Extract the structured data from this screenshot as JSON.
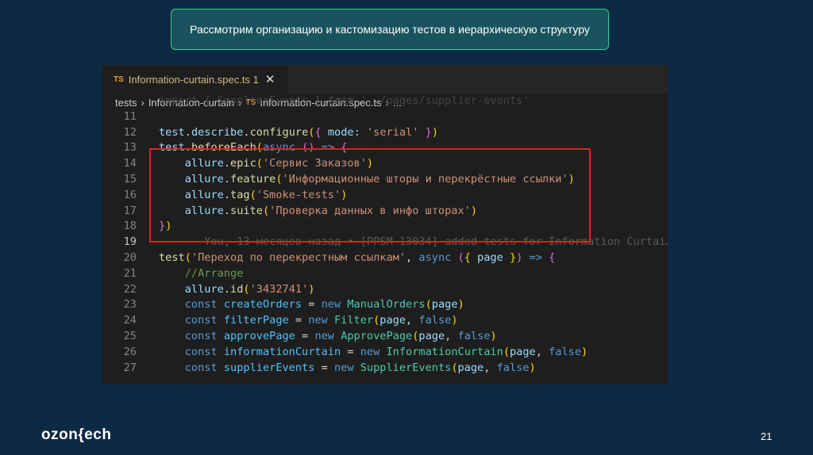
{
  "slide_title": "Рассмотрим организацию и кастомизацию тестов в иерархическую структуру",
  "editor": {
    "tab": {
      "icon": "TS",
      "label": "Information-curtain.spec.ts",
      "problems": "1",
      "close": "✕"
    },
    "breadcrumb": [
      "tests",
      "Information-curtain",
      "Information-curtain.spec.ts",
      "..."
    ],
    "lines": [
      {
        "n": "",
        "tokens": [
          [
            "import { SupplierEvents } from '../pages/supplier-events'",
            "dim"
          ]
        ]
      },
      {
        "n": "11",
        "tokens": []
      },
      {
        "n": "12",
        "tokens": [
          [
            "test",
            "obj"
          ],
          [
            ".",
            "p"
          ],
          [
            "describe",
            "obj"
          ],
          [
            ".",
            "p"
          ],
          [
            "configure",
            "fn"
          ],
          [
            "(",
            "br"
          ],
          [
            "{",
            "br2"
          ],
          [
            " mode: ",
            "obj"
          ],
          [
            "'serial'",
            "str"
          ],
          [
            " ",
            "p"
          ],
          [
            "}",
            "br2"
          ],
          [
            ")",
            "br"
          ]
        ]
      },
      {
        "n": "13",
        "tokens": [
          [
            "test",
            "obj"
          ],
          [
            ".",
            "p"
          ],
          [
            "beforeEach",
            "fn"
          ],
          [
            "(",
            "br"
          ],
          [
            "async",
            "kw"
          ],
          [
            " ",
            "p"
          ],
          [
            "()",
            "br2"
          ],
          [
            " => ",
            "kw"
          ],
          [
            "{",
            "br2"
          ]
        ]
      },
      {
        "n": "14",
        "tokens": [
          [
            "    allure",
            "obj"
          ],
          [
            ".",
            "p"
          ],
          [
            "epic",
            "fn"
          ],
          [
            "(",
            "br"
          ],
          [
            "'Сервис Заказов'",
            "str"
          ],
          [
            ")",
            "br"
          ]
        ]
      },
      {
        "n": "15",
        "tokens": [
          [
            "    allure",
            "obj"
          ],
          [
            ".",
            "p"
          ],
          [
            "feature",
            "fn"
          ],
          [
            "(",
            "br"
          ],
          [
            "'Информационные шторы и перекрёстные ссылки'",
            "str"
          ],
          [
            ")",
            "br"
          ]
        ]
      },
      {
        "n": "16",
        "tokens": [
          [
            "    allure",
            "obj"
          ],
          [
            ".",
            "p"
          ],
          [
            "tag",
            "fn"
          ],
          [
            "(",
            "br"
          ],
          [
            "'Smoke-tests'",
            "str"
          ],
          [
            ")",
            "br"
          ]
        ]
      },
      {
        "n": "17",
        "tokens": [
          [
            "    allure",
            "obj"
          ],
          [
            ".",
            "p"
          ],
          [
            "suite",
            "fn"
          ],
          [
            "(",
            "br"
          ],
          [
            "'Проверка данных в инфо шторах'",
            "str"
          ],
          [
            ")",
            "br"
          ]
        ]
      },
      {
        "n": "18",
        "tokens": [
          [
            "}",
            "br2"
          ],
          [
            ")",
            "br"
          ]
        ]
      },
      {
        "n": "19",
        "cur": true,
        "tokens": [
          [
            "       You, 13 месяцев назад • [PPSM-13034] added tests for Information Curtai…",
            "blame"
          ]
        ]
      },
      {
        "n": "20",
        "tokens": [
          [
            "test",
            "fn"
          ],
          [
            "(",
            "br"
          ],
          [
            "'Переход по перекрестным ссылкам'",
            "str"
          ],
          [
            ", ",
            "p"
          ],
          [
            "async",
            "kw"
          ],
          [
            " ",
            "p"
          ],
          [
            "(",
            "br2"
          ],
          [
            "{",
            "br"
          ],
          [
            " page ",
            "obj"
          ],
          [
            "}",
            "br"
          ],
          [
            ")",
            "br2"
          ],
          [
            " => ",
            "kw"
          ],
          [
            "{",
            "br2"
          ]
        ]
      },
      {
        "n": "21",
        "tokens": [
          [
            "    //Arrange",
            "cm"
          ]
        ]
      },
      {
        "n": "22",
        "tokens": [
          [
            "    allure",
            "obj"
          ],
          [
            ".",
            "p"
          ],
          [
            "id",
            "fn"
          ],
          [
            "(",
            "br"
          ],
          [
            "'3432741'",
            "str"
          ],
          [
            ")",
            "br"
          ]
        ]
      },
      {
        "n": "23",
        "tokens": [
          [
            "    const ",
            "kw"
          ],
          [
            "createOrders",
            "var"
          ],
          [
            " = ",
            "p"
          ],
          [
            "new ",
            "kw"
          ],
          [
            "ManualOrders",
            "cls"
          ],
          [
            "(",
            "br"
          ],
          [
            "page",
            "obj"
          ],
          [
            ")",
            "br"
          ]
        ]
      },
      {
        "n": "24",
        "tokens": [
          [
            "    const ",
            "kw"
          ],
          [
            "filterPage",
            "var"
          ],
          [
            " = ",
            "p"
          ],
          [
            "new ",
            "kw"
          ],
          [
            "Filter",
            "cls"
          ],
          [
            "(",
            "br"
          ],
          [
            "page",
            "obj"
          ],
          [
            ", ",
            "p"
          ],
          [
            "false",
            "kw"
          ],
          [
            ")",
            "br"
          ]
        ]
      },
      {
        "n": "25",
        "tokens": [
          [
            "    const ",
            "kw"
          ],
          [
            "approvePage",
            "var"
          ],
          [
            " = ",
            "p"
          ],
          [
            "new ",
            "kw"
          ],
          [
            "ApprovePage",
            "cls"
          ],
          [
            "(",
            "br"
          ],
          [
            "page",
            "obj"
          ],
          [
            ", ",
            "p"
          ],
          [
            "false",
            "kw"
          ],
          [
            ")",
            "br"
          ]
        ]
      },
      {
        "n": "26",
        "tokens": [
          [
            "    const ",
            "kw"
          ],
          [
            "informationCurtain",
            "var"
          ],
          [
            " = ",
            "p"
          ],
          [
            "new ",
            "kw"
          ],
          [
            "InformationCurtain",
            "cls"
          ],
          [
            "(",
            "br"
          ],
          [
            "page",
            "obj"
          ],
          [
            ", ",
            "p"
          ],
          [
            "false",
            "kw"
          ],
          [
            ")",
            "br"
          ]
        ]
      },
      {
        "n": "27",
        "tokens": [
          [
            "    const ",
            "kw"
          ],
          [
            "supplierEvents",
            "var"
          ],
          [
            " = ",
            "p"
          ],
          [
            "new ",
            "kw"
          ],
          [
            "SupplierEvents",
            "cls"
          ],
          [
            "(",
            "br"
          ],
          [
            "page",
            "obj"
          ],
          [
            ", ",
            "p"
          ],
          [
            "false",
            "kw"
          ],
          [
            ")",
            "br"
          ]
        ]
      }
    ]
  },
  "footer": {
    "logo": "ozon{ech",
    "page_number": "21"
  }
}
